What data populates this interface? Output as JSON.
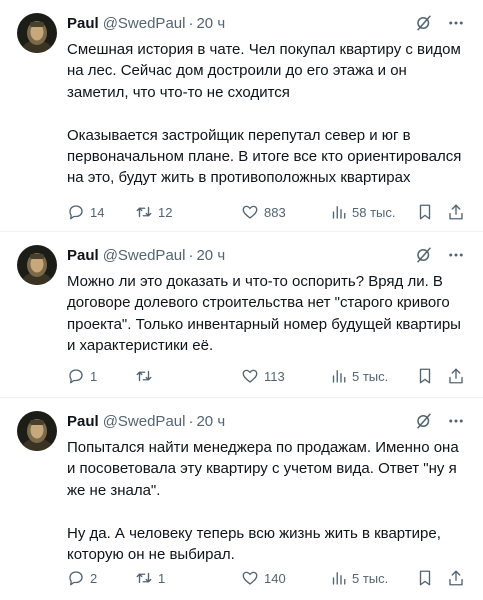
{
  "thread": {
    "tweets": [
      {
        "author": {
          "name": "Paul",
          "handle": "@SwedPaul"
        },
        "time": "20 ч",
        "paragraphs": [
          "Смешная история в чате. Чел покупал квартиру с видом на лес. Сейчас дом достроили до его этажа и он заметил, что что-то не сходится",
          "Оказывается застройщик перепутал север и юг в первоначальном плане. В итоге все кто ориентировался на это, будут жить в противоположных квартирах"
        ],
        "stats": {
          "replies": "14",
          "retweets": "12",
          "likes": "883",
          "views": "58 тыс."
        }
      },
      {
        "author": {
          "name": "Paul",
          "handle": "@SwedPaul"
        },
        "time": "20 ч",
        "paragraphs": [
          "Можно ли это доказать и что-то оспорить? Вряд ли. В договоре долевого строительства нет \"старого кривого проекта\". Только инвентарный номер будущей квартиры и характеристики её."
        ],
        "stats": {
          "replies": "1",
          "retweets": "",
          "likes": "113",
          "views": "5 тыс."
        }
      },
      {
        "author": {
          "name": "Paul",
          "handle": "@SwedPaul"
        },
        "time": "20 ч",
        "paragraphs": [
          "Попытался найти менеджера по продажам. Именно она и посоветовала эту квартиру с учетом вида. Ответ \"ну я же не знала\".",
          "Ну да. А человеку теперь всю жизнь жить в квартире, которую он не выбирал."
        ],
        "stats": {
          "replies": "2",
          "retweets": "1",
          "likes": "140",
          "views": "5 тыс."
        }
      }
    ],
    "separator": "·",
    "icons": {
      "header": [
        "grok-icon",
        "more-icon"
      ],
      "actions": [
        "reply-icon",
        "retweet-icon",
        "like-icon",
        "views-icon",
        "bookmark-icon",
        "share-icon"
      ]
    },
    "colors": {
      "text": "#0f1419",
      "secondary": "#536471",
      "divider": "#eff3f4"
    }
  }
}
